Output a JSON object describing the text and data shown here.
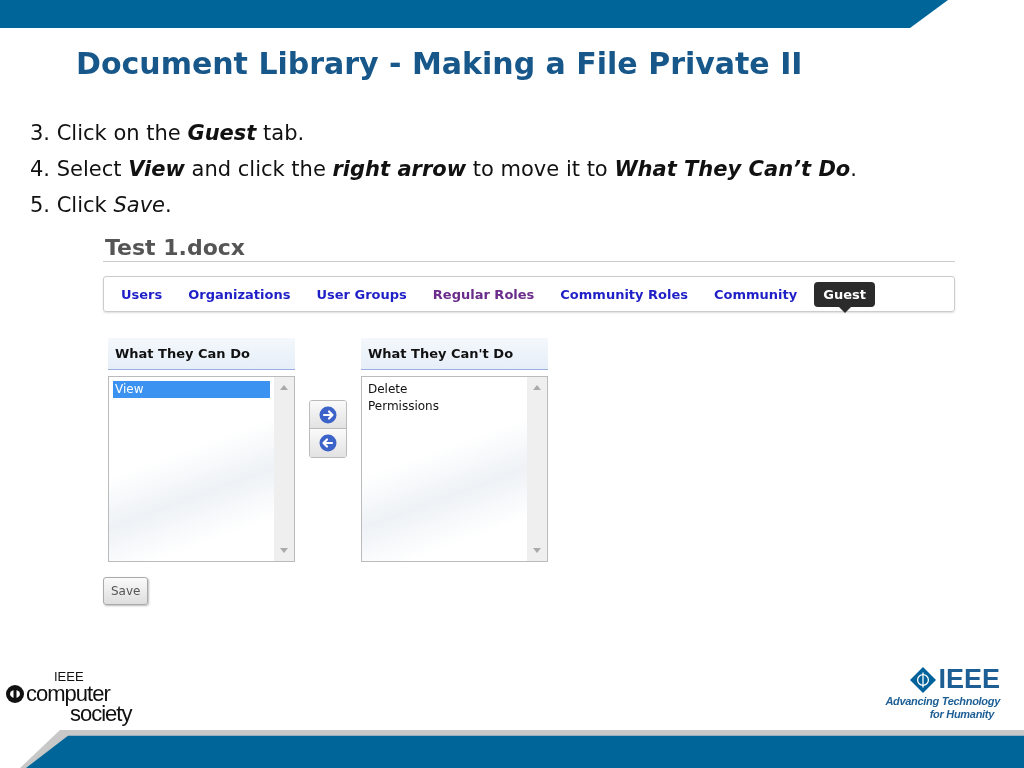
{
  "slide_title": "Document Library - Making a File Private II",
  "steps": [
    "3. Click on the **Guest** tab.",
    "4. Select **View** and click the **right arrow** to move it to **What They Can’t Do**.",
    "5. Click *Save*."
  ],
  "screenshot": {
    "file_title": "Test 1.docx",
    "tabs": [
      {
        "label": "Users",
        "selected": false,
        "visited": false
      },
      {
        "label": "Organizations",
        "selected": false,
        "visited": false
      },
      {
        "label": "User Groups",
        "selected": false,
        "visited": false
      },
      {
        "label": "Regular Roles",
        "selected": false,
        "visited": true
      },
      {
        "label": "Community Roles",
        "selected": false,
        "visited": false
      },
      {
        "label": "Community",
        "selected": false,
        "visited": false
      },
      {
        "label": "Guest",
        "selected": true,
        "visited": false
      }
    ],
    "lists": [
      {
        "heading": "What They Can Do",
        "items": [
          {
            "label": "View",
            "selected": true
          }
        ]
      },
      {
        "heading": "What They Can't Do",
        "items": [
          {
            "label": "Delete",
            "selected": false
          },
          {
            "label": "Permissions",
            "selected": false
          }
        ]
      }
    ],
    "move_buttons": [
      {
        "kind": "right"
      },
      {
        "kind": "left"
      }
    ],
    "save_button": "Save"
  },
  "footer": {
    "left_logo": [
      "IEEE",
      "computer",
      "society"
    ],
    "right_logo": [
      "IEEE",
      "Advancing Technology",
      "for Humanity"
    ]
  }
}
